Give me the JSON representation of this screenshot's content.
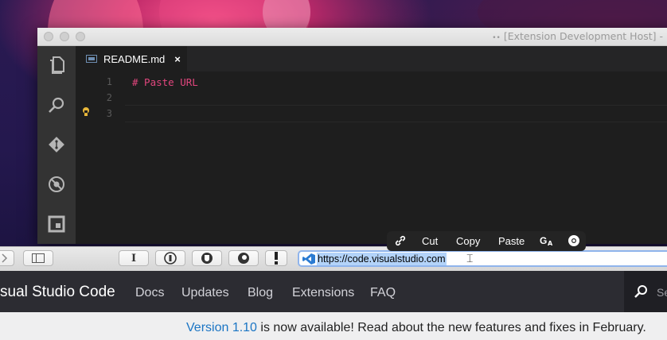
{
  "vscode": {
    "window_title": "[Extension Development Host] -",
    "tab": {
      "label": "README.md",
      "close": "×"
    },
    "editor": {
      "line_numbers": [
        "1",
        "2",
        "3"
      ],
      "lines": [
        "# Paste URL",
        "",
        ""
      ],
      "lightbulb_icon": "lightbulb-icon"
    },
    "activity_icons": [
      "explorer-icon",
      "search-icon",
      "git-icon",
      "debug-icon",
      "extensions-icon"
    ]
  },
  "context_menu": {
    "link_icon": "link-icon",
    "items": [
      "Cut",
      "Copy",
      "Paste"
    ],
    "translate_icon": "translate-icon",
    "chrome_icon": "chrome-icon"
  },
  "browser": {
    "toolbar_buttons": [
      "I"
    ],
    "address": {
      "url": "https://code.visualstudio.com",
      "favicon": "vscode-logo-icon"
    }
  },
  "site": {
    "brand": "sual Studio Code",
    "nav": [
      "Docs",
      "Updates",
      "Blog",
      "Extensions",
      "FAQ"
    ],
    "search_placeholder": "Se"
  },
  "banner": {
    "link_text": "Version 1.10",
    "text": " is now available! Read about the new features and fixes in February."
  },
  "colors": {
    "editor_bg": "#1e1e1e",
    "activity_bar": "#333333",
    "markdown_heading": "#e2467e",
    "site_nav_bg": "#2c2c32",
    "link": "#1b75c4"
  }
}
